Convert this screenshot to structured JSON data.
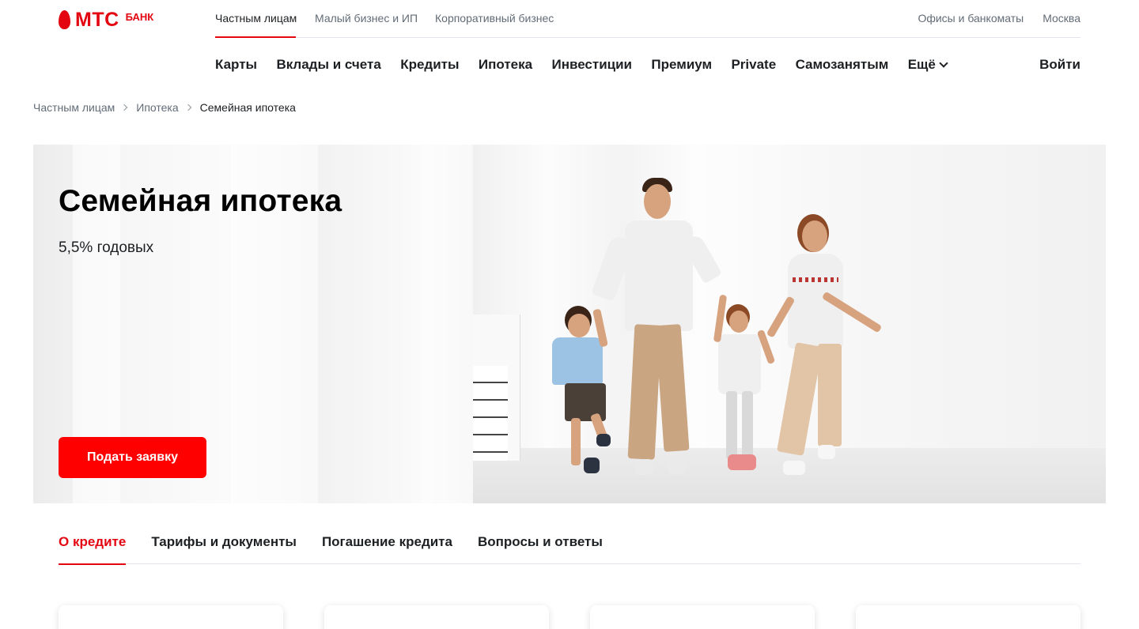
{
  "brand": {
    "name": "МТС",
    "suffix": "БАНК",
    "accent": "#e30611"
  },
  "segments": {
    "items": [
      "Частным лицам",
      "Малый бизнес и ИП",
      "Корпоративный бизнес"
    ],
    "active": "Частным лицам",
    "offices": "Офисы и банкоматы",
    "city": "Москва"
  },
  "nav": {
    "items": [
      "Карты",
      "Вклады и счета",
      "Кредиты",
      "Ипотека",
      "Инвестиции",
      "Премиум",
      "Private",
      "Самозанятым",
      "Ещё"
    ],
    "more_icon": "chevron-down-icon",
    "login": "Войти"
  },
  "breadcrumb": [
    "Частным лицам",
    "Ипотека",
    "Семейная ипотека"
  ],
  "hero": {
    "title": "Семейная ипотека",
    "subtitle": "5,5% годовых",
    "button": "Подать заявку",
    "button_color": "#ff0000"
  },
  "tabs": {
    "items": [
      "О кредите",
      "Тарифы и документы",
      "Погашение кредита",
      "Вопросы и ответы"
    ],
    "active": "О кредите"
  }
}
